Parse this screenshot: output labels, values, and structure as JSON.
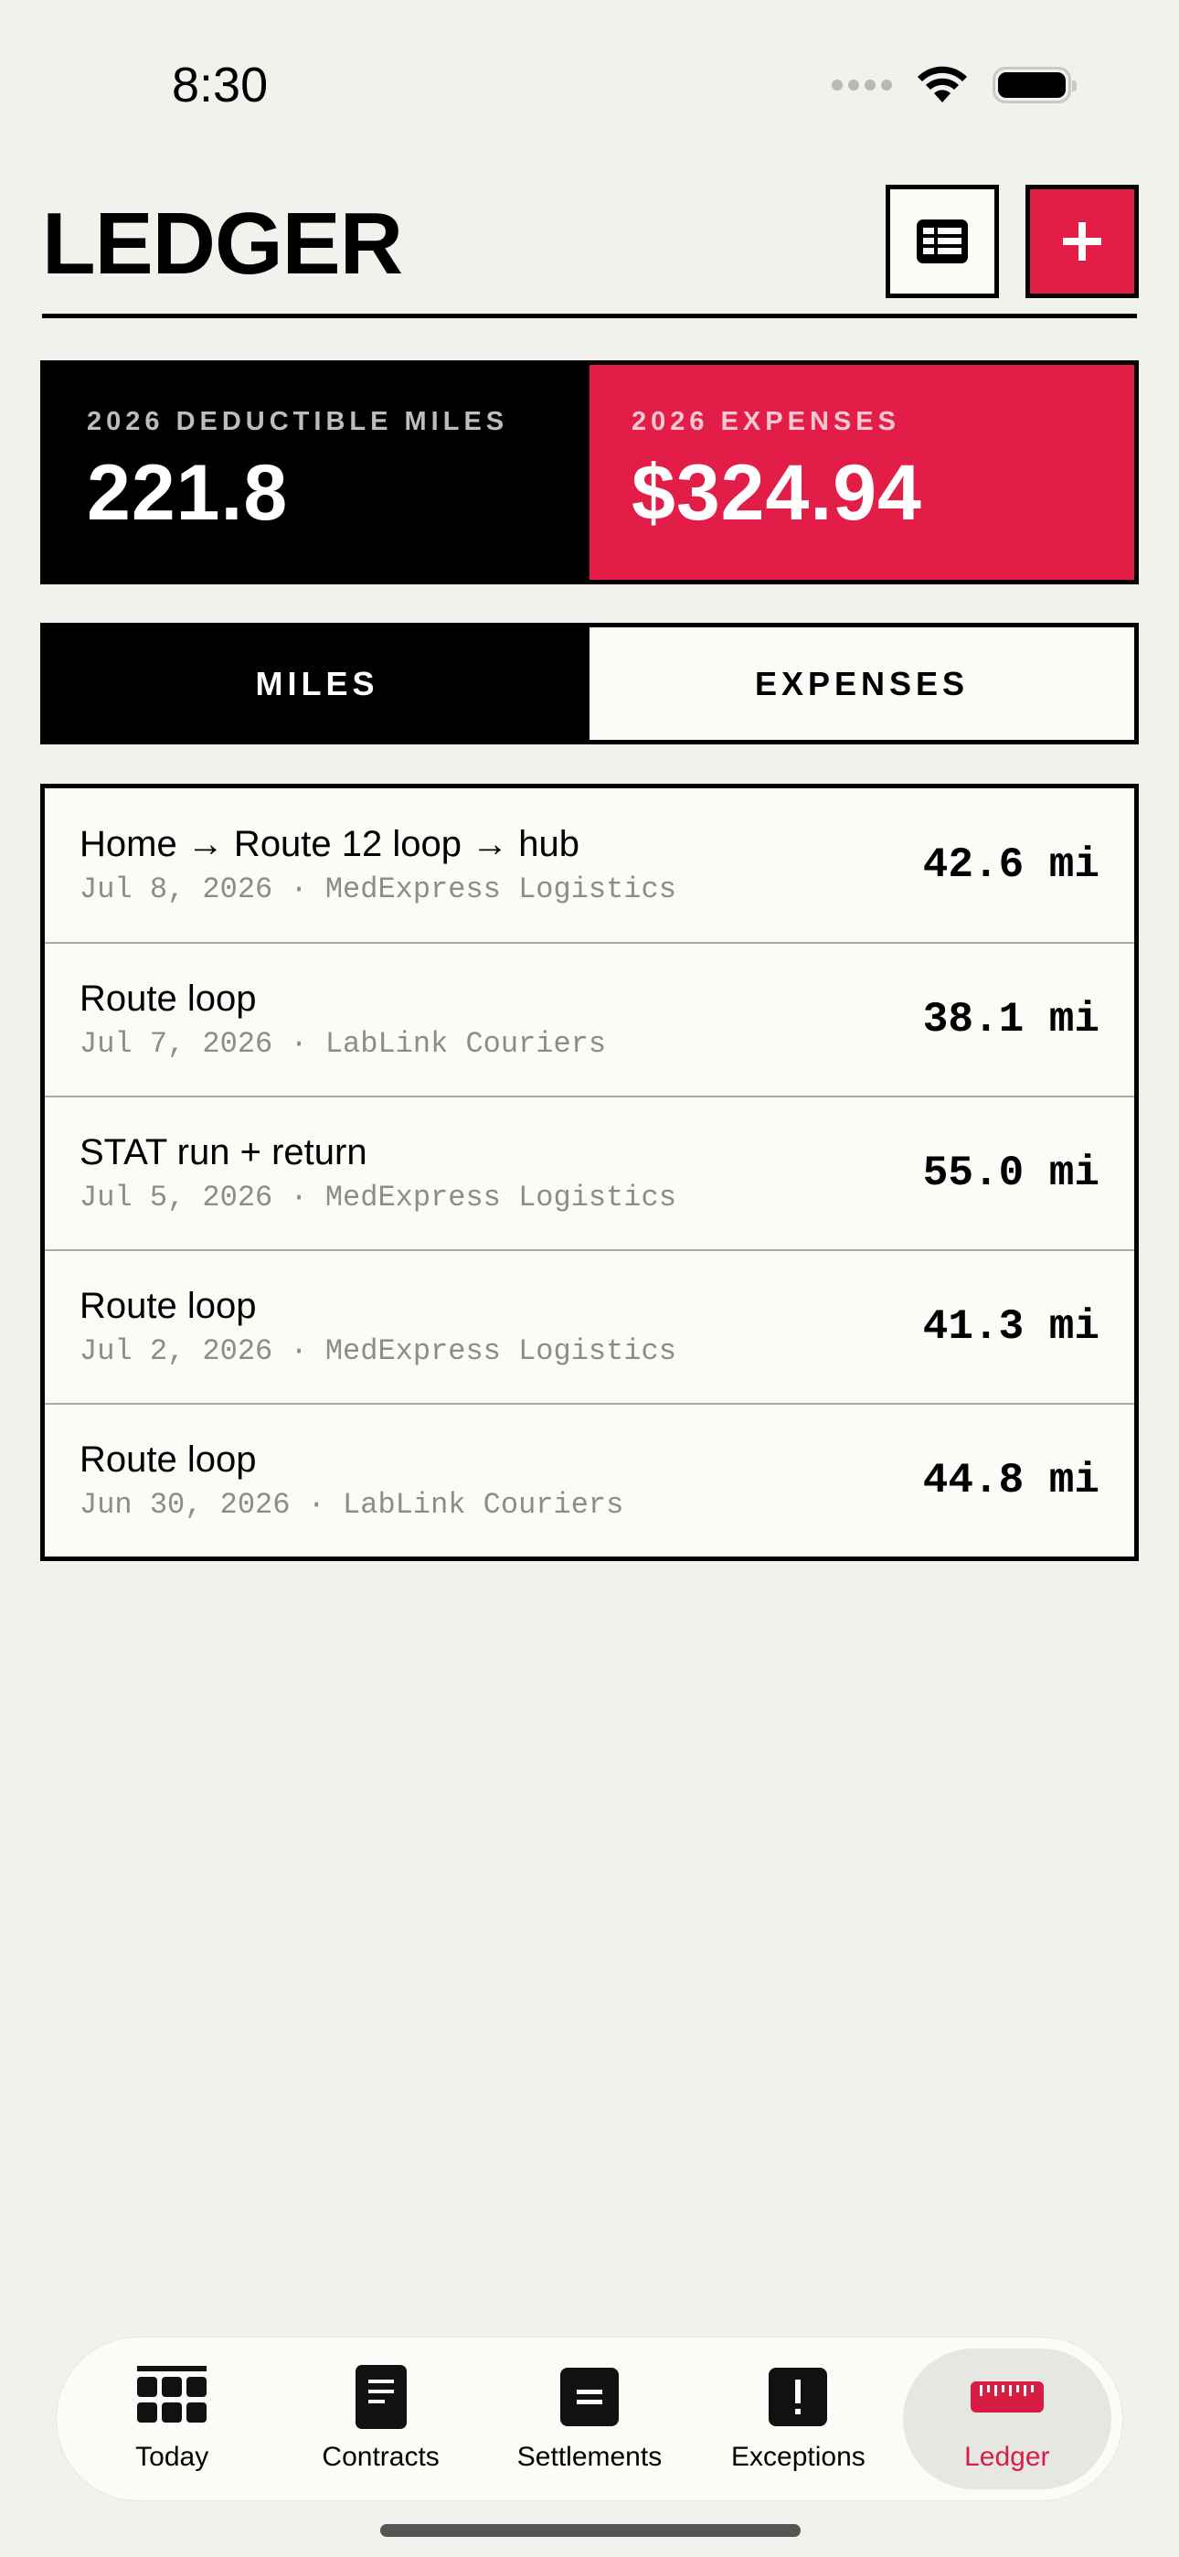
{
  "status_bar": {
    "time": "8:30"
  },
  "header": {
    "title": "LEDGER"
  },
  "summary": {
    "miles_label": "2026 DEDUCTIBLE MILES",
    "miles_value": "221.8",
    "expenses_label": "2026 EXPENSES",
    "expenses_value": "$324.94"
  },
  "tabs": [
    {
      "label": "MILES",
      "active": true
    },
    {
      "label": "EXPENSES",
      "active": false
    }
  ],
  "entries": [
    {
      "title": "Home → Route 12 loop → hub",
      "subtitle": "Jul 8, 2026 · MedExpress Logistics",
      "value": "42.6 mi"
    },
    {
      "title": "Route loop",
      "subtitle": "Jul 7, 2026 · LabLink Couriers",
      "value": "38.1 mi"
    },
    {
      "title": "STAT run + return",
      "subtitle": "Jul 5, 2026 · MedExpress Logistics",
      "value": "55.0 mi"
    },
    {
      "title": "Route loop",
      "subtitle": "Jul 2, 2026 · MedExpress Logistics",
      "value": "41.3 mi"
    },
    {
      "title": "Route loop",
      "subtitle": "Jun 30, 2026 · LabLink Couriers",
      "value": "44.8 mi"
    }
  ],
  "nav": [
    {
      "label": "Today",
      "icon": "grid-icon",
      "active": false
    },
    {
      "label": "Contracts",
      "icon": "document-icon",
      "active": false
    },
    {
      "label": "Settlements",
      "icon": "equals-icon",
      "active": false
    },
    {
      "label": "Exceptions",
      "icon": "exclamation-icon",
      "active": false
    },
    {
      "label": "Ledger",
      "icon": "ruler-icon",
      "active": true
    }
  ],
  "colors": {
    "accent": "#e21d48",
    "ink": "#000000",
    "background": "#f1f1ee",
    "card": "#fbfbf8"
  }
}
